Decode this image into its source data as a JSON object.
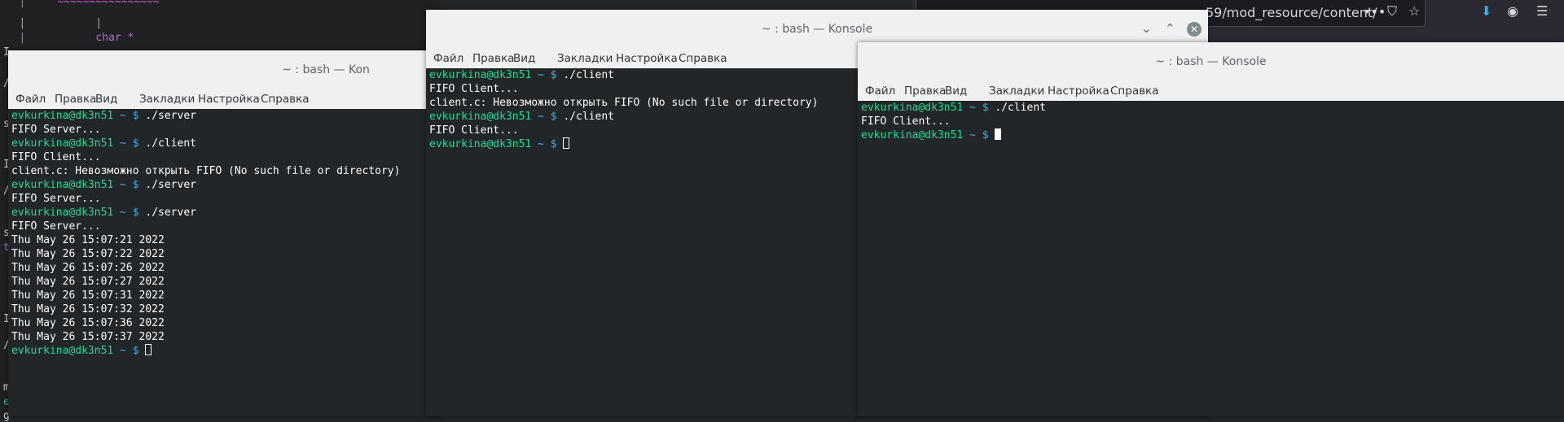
{
  "background_editor": {
    "lines": [
      {
        "text": "   |    ^~~~~~~~~~~~~~~~~",
        "cls": "c-pink"
      },
      {
        "text": "   |           |",
        "cls": "c-gray"
      },
      {
        "text": "   |           char *",
        "cls": "c-purple"
      }
    ],
    "edge_chars": [
      "I",
      "/",
      "s",
      "I",
      "/",
      "s",
      "t",
      "I",
      "/",
      "m",
      "e",
      "g"
    ]
  },
  "background_browser": {
    "url": "59/mod_resource/content/"
  },
  "left_window": {
    "title": "~ : bash — Kon",
    "menu": [
      "Файл",
      "Правка",
      "Вид",
      "Закладки",
      "Настройка",
      "Справка"
    ],
    "lines": [
      {
        "user": "evkurkina@dk3n51",
        "sym": " ~ $ ",
        "cmd": "./server"
      },
      {
        "out": "FIFO Server..."
      },
      {
        "user": "evkurkina@dk3n51",
        "sym": " ~ $ ",
        "cmd": "./client"
      },
      {
        "out": "FIFO Client..."
      },
      {
        "out": "client.c: Невозможно открыть FIFO (No such file or directory)"
      },
      {
        "user": "evkurkina@dk3n51",
        "sym": " ~ $ ",
        "cmd": "./server"
      },
      {
        "out": "FIFO Server..."
      },
      {
        "user": "evkurkina@dk3n51",
        "sym": " ~ $ ",
        "cmd": "./server"
      },
      {
        "out": "FIFO Server..."
      },
      {
        "out": "Thu May 26 15:07:21 2022"
      },
      {
        "out": "Thu May 26 15:07:22 2022"
      },
      {
        "out": "Thu May 26 15:07:26 2022"
      },
      {
        "out": "Thu May 26 15:07:27 2022"
      },
      {
        "out": "Thu May 26 15:07:31 2022"
      },
      {
        "out": "Thu May 26 15:07:32 2022"
      },
      {
        "out": "Thu May 26 15:07:36 2022"
      },
      {
        "out": "Thu May 26 15:07:37 2022"
      },
      {
        "user": "evkurkina@dk3n51",
        "sym": " ~ $ ",
        "cmd": "",
        "cursor": "hollow"
      }
    ]
  },
  "middle_window": {
    "title": "~ : bash — Konsole",
    "menu": [
      "Файл",
      "Правка",
      "Вид",
      "Закладки",
      "Настройка",
      "Справка"
    ],
    "lines": [
      {
        "user": "evkurkina@dk3n51",
        "sym": " ~ $ ",
        "cmd": "./client"
      },
      {
        "out": "FIFO Client..."
      },
      {
        "out": "client.c: Невозможно открыть FIFO (No such file or directory)"
      },
      {
        "user": "evkurkina@dk3n51",
        "sym": " ~ $ ",
        "cmd": "./client"
      },
      {
        "out": "FIFO Client..."
      },
      {
        "user": "evkurkina@dk3n51",
        "sym": " ~ $ ",
        "cmd": "",
        "cursor": "hollow"
      }
    ]
  },
  "right_window": {
    "title": "~ : bash — Konsole",
    "menu": [
      "Файл",
      "Правка",
      "Вид",
      "Закладки",
      "Настройка",
      "Справка"
    ],
    "lines": [
      {
        "user": "evkurkina@dk3n51",
        "sym": " ~ $ ",
        "cmd": "./client"
      },
      {
        "out": "FIFO Client..."
      },
      {
        "user": "evkurkina@dk3n51",
        "sym": " ~ $ ",
        "cmd": "",
        "cursor": "filled"
      }
    ]
  },
  "colors": {
    "terminal_bg": "#232629",
    "prompt_user": "#1cdc9a",
    "prompt_symbol": "#3daee9",
    "titlebar_bg": "#eff0f1"
  }
}
